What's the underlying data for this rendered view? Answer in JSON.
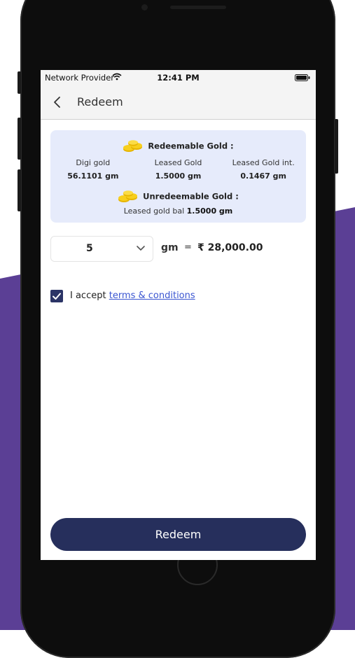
{
  "colors": {
    "accent_navy": "#262f5c",
    "card_bg": "#e6ebfb",
    "link": "#3a55d1",
    "background_purple": "#5b3f95"
  },
  "status_bar": {
    "provider": "Network Provider",
    "time": "12:41 PM",
    "wifi_icon": "wifi-icon",
    "battery_icon": "battery-icon"
  },
  "header": {
    "back_icon": "chevron-left-icon",
    "title": "Redeem"
  },
  "redeemable": {
    "heading": "Redeemable Gold :",
    "icon": "gold-coins-icon",
    "items": [
      {
        "label": "Digi gold",
        "value": "56.1101 gm"
      },
      {
        "label": "Leased Gold",
        "value": "1.5000 gm"
      },
      {
        "label": "Leased Gold int.",
        "value": "0.1467 gm"
      }
    ]
  },
  "unredeemable": {
    "heading": "Unredeemable Gold :",
    "icon": "gold-coins-icon",
    "label": "Leased gold bal",
    "value": "1.5000 gm"
  },
  "quantity": {
    "selected": "5",
    "unit": "gm",
    "equals": "=",
    "amount": "₹ 28,000.00"
  },
  "terms": {
    "checked": true,
    "prefix": "I accept",
    "link_text": "terms & conditions"
  },
  "action": {
    "redeem_label": "Redeem"
  }
}
